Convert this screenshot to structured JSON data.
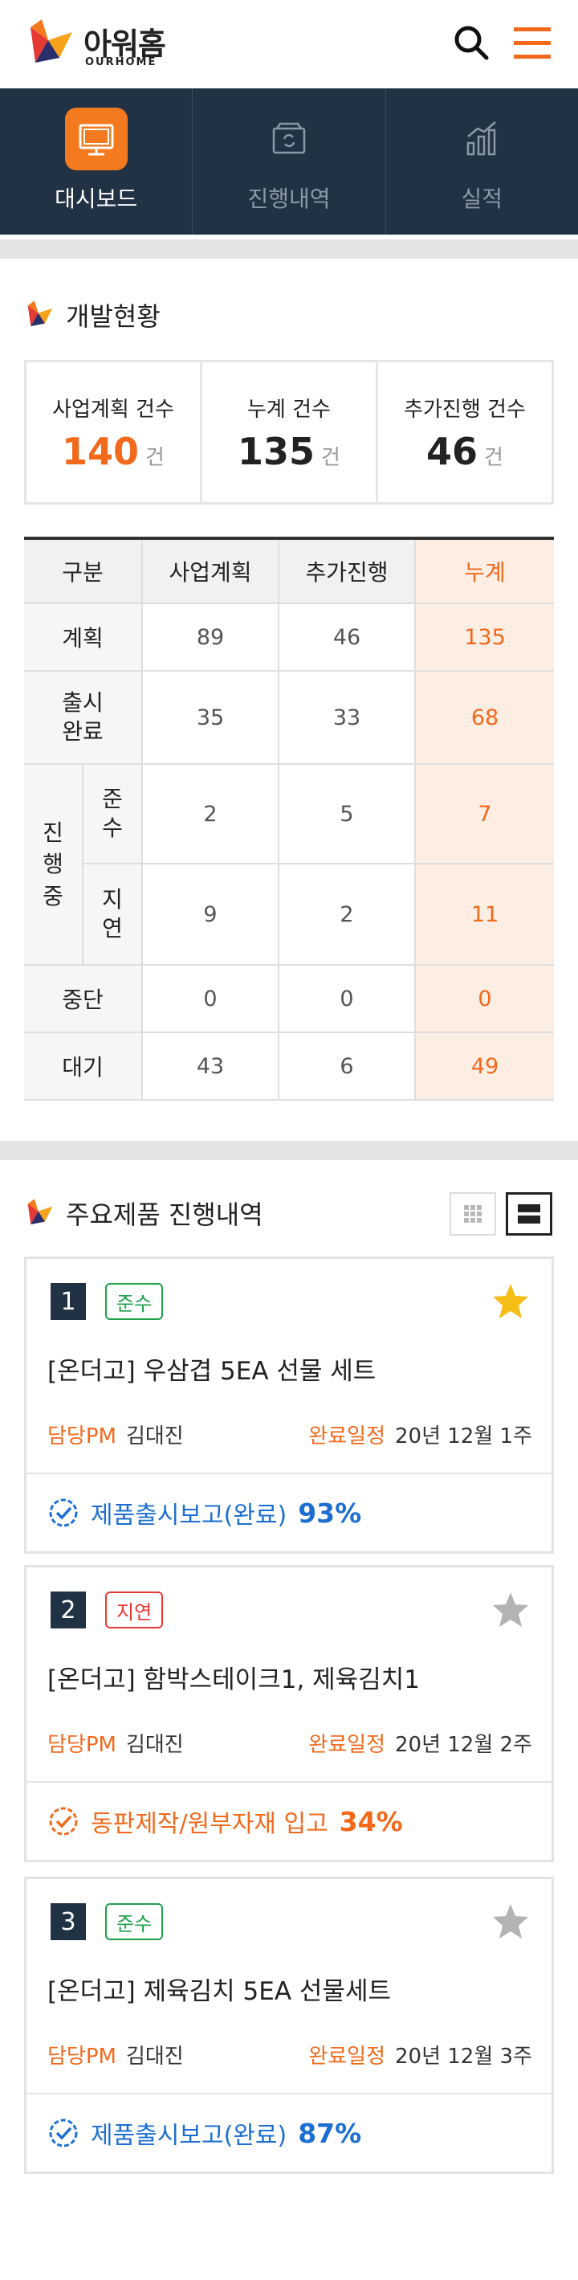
{
  "brand": {
    "name_ko": "아워홈",
    "name_en": "OURHOME"
  },
  "colors": {
    "navy": "#223245",
    "accent_orange": "#f2691c",
    "nav_active": "#f47a1f",
    "blue": "#1c6fd1",
    "green": "#1ea04a",
    "red": "#e53935",
    "star_gold": "#f6bd16",
    "star_gray": "#b3b3b3"
  },
  "header": {
    "search_icon": "search-icon",
    "menu_icon": "hamburger-menu-icon"
  },
  "nav": {
    "tabs": [
      {
        "label": "대시보드",
        "icon": "monitor-icon",
        "active": true
      },
      {
        "label": "진행내역",
        "icon": "box-refresh-icon",
        "active": false
      },
      {
        "label": "실적",
        "icon": "bar-chart-icon",
        "active": false
      }
    ]
  },
  "development": {
    "title": "개발현황",
    "stats": [
      {
        "label": "사업계획 건수",
        "value": "140",
        "unit": "건",
        "highlight": true
      },
      {
        "label": "누계 건수",
        "value": "135",
        "unit": "건",
        "highlight": false
      },
      {
        "label": "추가진행 건수",
        "value": "46",
        "unit": "건",
        "highlight": false
      }
    ],
    "table": {
      "headers": [
        "구분",
        "사업계획",
        "추가진행",
        "누계"
      ],
      "group_label": "진행중",
      "rows": [
        {
          "label": "계획",
          "plan": "89",
          "extra": "46",
          "total": "135"
        },
        {
          "label": "출시완료",
          "plan": "35",
          "extra": "33",
          "total": "68"
        },
        {
          "label": "준수",
          "plan": "2",
          "extra": "5",
          "total": "7"
        },
        {
          "label": "지연",
          "plan": "9",
          "extra": "2",
          "total": "11"
        },
        {
          "label": "중단",
          "plan": "0",
          "extra": "0",
          "total": "0"
        },
        {
          "label": "대기",
          "plan": "43",
          "extra": "6",
          "total": "49"
        }
      ]
    }
  },
  "products": {
    "title": "주요제품 진행내역",
    "view_modes": [
      "grid-view-icon",
      "list-view-icon"
    ],
    "pm_label": "담당PM",
    "due_label": "완료일정",
    "items": [
      {
        "num": "1",
        "status": "준수",
        "title": "[온더고] 우삼겹 5EA 선물 세트",
        "pm": "김대진",
        "due": "20년 12월 1주",
        "stage": "제품출시보고(완료)",
        "progress": "93%",
        "starred": true
      },
      {
        "num": "2",
        "status": "지연",
        "title": "[온더고] 함박스테이크1, 제육김치1",
        "pm": "김대진",
        "due": "20년 12월 2주",
        "stage": "동판제작/원부자재 입고",
        "progress": "34%",
        "starred": false
      },
      {
        "num": "3",
        "status": "준수",
        "title": "[온더고] 제육김치 5EA 선물세트",
        "pm": "김대진",
        "due": "20년 12월 3주",
        "stage": "제품출시보고(완료)",
        "progress": "87%",
        "starred": false
      }
    ]
  }
}
